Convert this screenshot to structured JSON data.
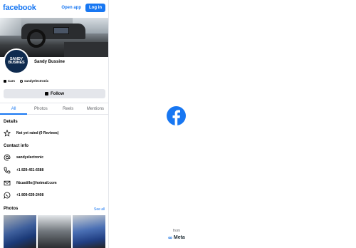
{
  "header": {
    "logo": "facebook",
    "open_app": "Open app",
    "login": "Log in"
  },
  "profile": {
    "avatar_text": "SANDY BUSINES",
    "name": "Sandy Bussine",
    "category": "Cars",
    "username": "sandyelectronic",
    "follow_label": "Follow"
  },
  "tabs": [
    {
      "label": "All",
      "active": true
    },
    {
      "label": "Photos",
      "active": false
    },
    {
      "label": "Reels",
      "active": false
    },
    {
      "label": "Mentions",
      "active": false
    }
  ],
  "details": {
    "title": "Details",
    "rating": "Not yet rated (0 Reviews)"
  },
  "contact": {
    "title": "Contact info",
    "username": "sandyelectronic",
    "phone": "+1 829-451-6588",
    "email": "fttcastillo@hotmail.com",
    "whatsapp": "+1 809-639-2408"
  },
  "photos": {
    "title": "Photos",
    "see_all": "See all"
  },
  "footer": {
    "from": "from",
    "brand": "Meta"
  },
  "colors": {
    "brand": "#1877f2",
    "follow_bg": "#e4e6eb"
  }
}
